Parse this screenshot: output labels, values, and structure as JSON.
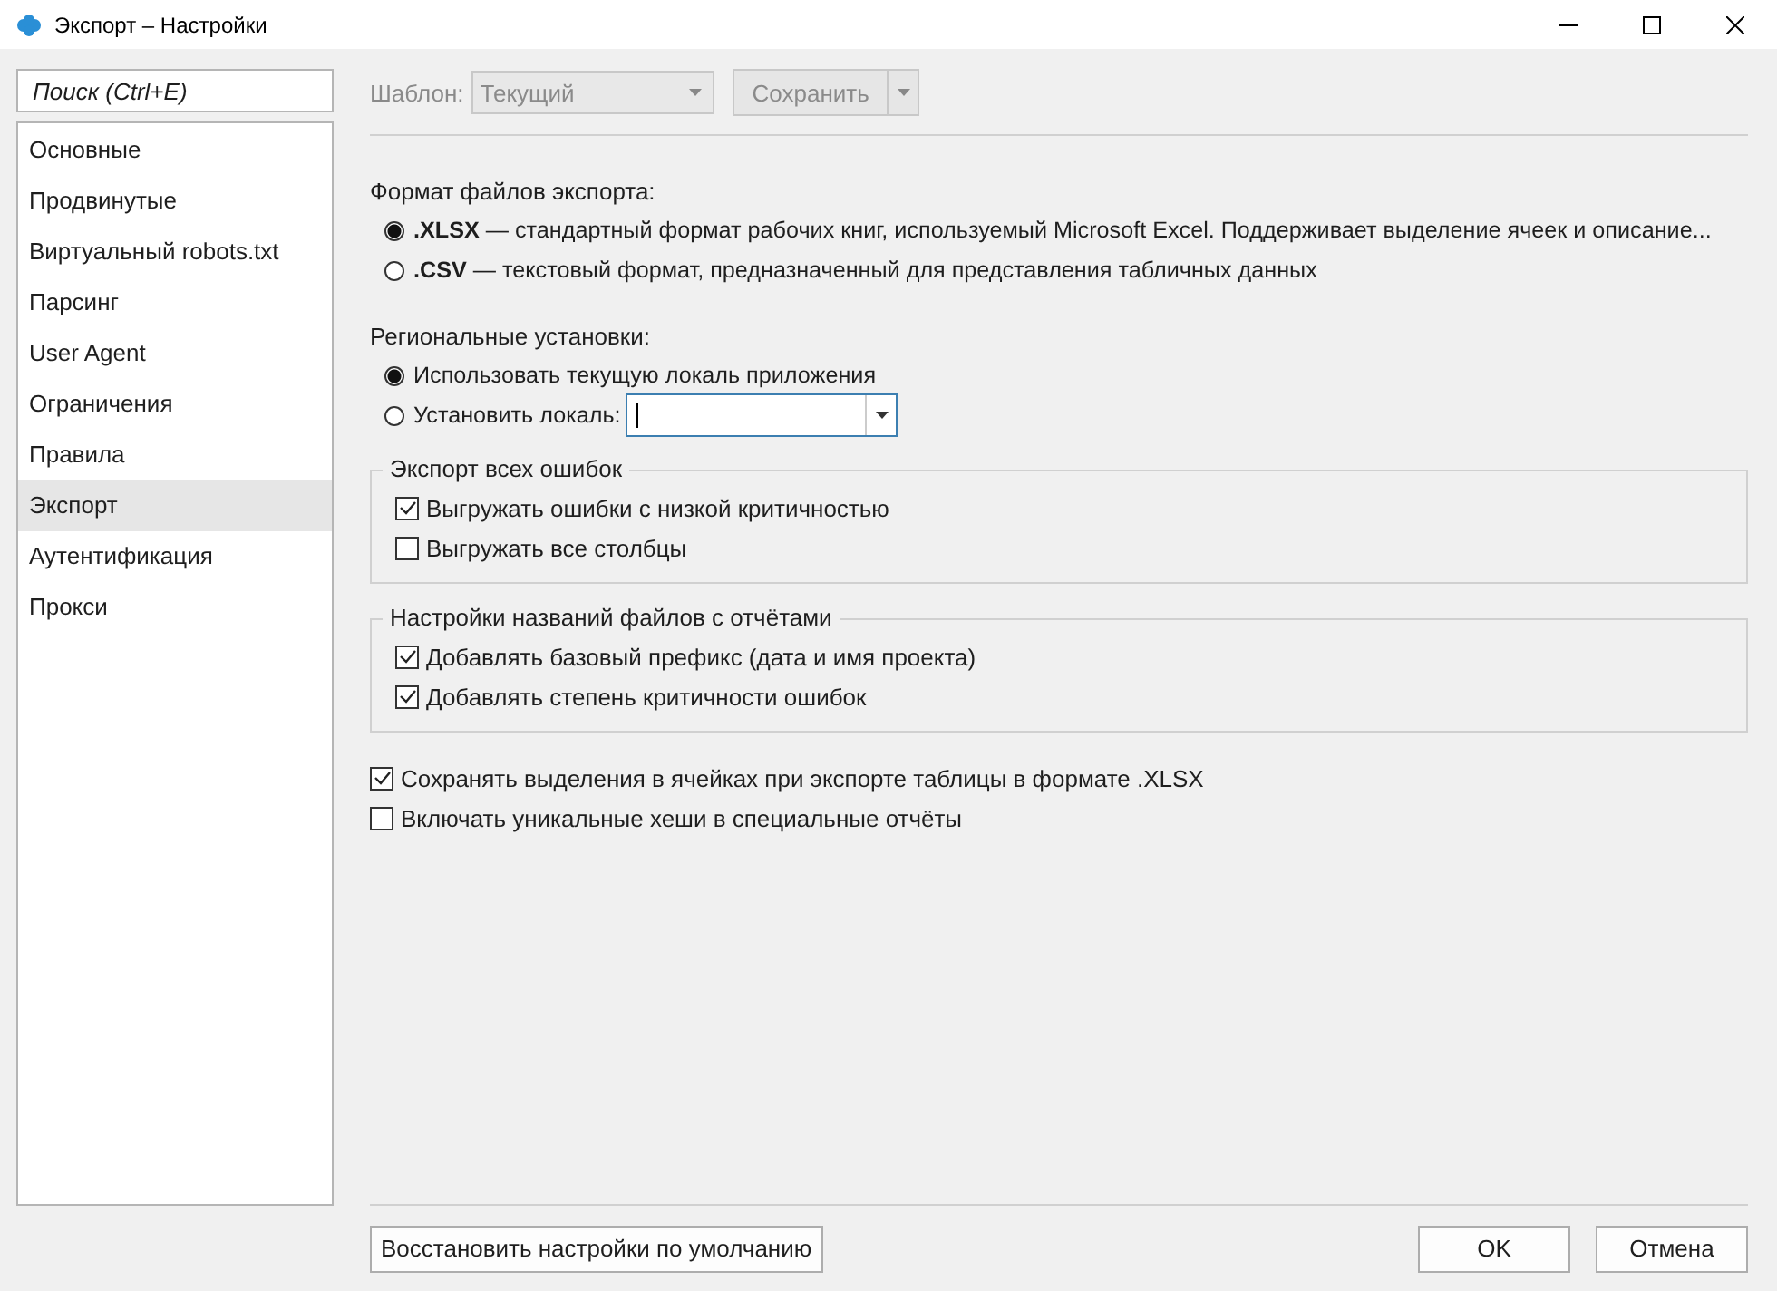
{
  "window": {
    "title": "Экспорт – Настройки"
  },
  "sidebar": {
    "search": {
      "placeholder": "Поиск (Ctrl+E)"
    },
    "items": [
      {
        "label": "Основные",
        "selected": false
      },
      {
        "label": "Продвинутые",
        "selected": false
      },
      {
        "label": "Виртуальный robots.txt",
        "selected": false
      },
      {
        "label": "Парсинг",
        "selected": false
      },
      {
        "label": "User Agent",
        "selected": false
      },
      {
        "label": "Ограничения",
        "selected": false
      },
      {
        "label": "Правила",
        "selected": false
      },
      {
        "label": "Экспорт",
        "selected": true
      },
      {
        "label": "Аутентификация",
        "selected": false
      },
      {
        "label": "Прокси",
        "selected": false
      }
    ]
  },
  "toolbar": {
    "template_label": "Шаблон:",
    "template_value": "Текущий",
    "save_button": "Сохранить",
    "disabled": true
  },
  "export_format": {
    "label": "Формат файлов экспорта:",
    "options": [
      {
        "text": "**.XLSX** — стандартный формат рабочих книг, используемый Microsoft Excel. Поддерживает выделение ячеек и описание...",
        "selected": true
      },
      {
        "text": "**.CSV** — текстовый формат, предназначенный для представления табличных данных",
        "selected": false
      }
    ]
  },
  "regional": {
    "label": "Региональные установки:",
    "options": [
      {
        "kind": "plain",
        "text": "Использовать текущую локаль приложения",
        "selected": true
      },
      {
        "kind": "dropdown",
        "text": "Установить локаль:",
        "selected": false
      }
    ]
  },
  "groups": [
    {
      "title": "Экспорт всех ошибок",
      "items": [
        {
          "label": "Выгружать ошибки с низкой критичностью",
          "checked": true
        },
        {
          "label": "Выгружать все столбцы",
          "checked": false
        }
      ]
    },
    {
      "title": "Настройки названий файлов с отчётами",
      "items": [
        {
          "label": "Добавлять базовый префикс (дата и имя проекта)",
          "checked": true
        },
        {
          "label": "Добавлять степень критичности ошибок",
          "checked": true
        }
      ]
    }
  ],
  "options": [
    {
      "label": "Сохранять выделения в ячейках при экспорте таблицы в формате .XLSX",
      "checked": true
    },
    {
      "label": "Включать уникальные хеши в специальные отчёты",
      "checked": false
    }
  ],
  "footer": {
    "reset_button": "Восстановить настройки по умолчанию",
    "ok_button": "OK",
    "cancel_button": "Отмена"
  }
}
